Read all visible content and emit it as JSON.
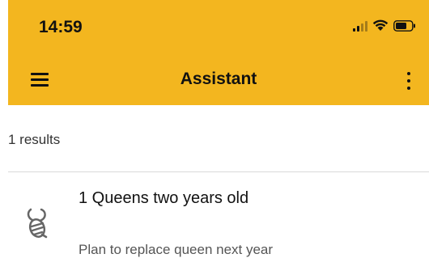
{
  "status_bar": {
    "time": "14:59"
  },
  "header": {
    "title": "Assistant",
    "background_color": "#f3b61f",
    "menu_icon": "hamburger-menu-icon",
    "more_icon": "vertical-dots-icon"
  },
  "results": {
    "count_label": "1 results",
    "items": [
      {
        "icon": "bee-icon",
        "title": "1 Queens two years old",
        "subtitle": "Plan to replace queen next year"
      }
    ]
  }
}
